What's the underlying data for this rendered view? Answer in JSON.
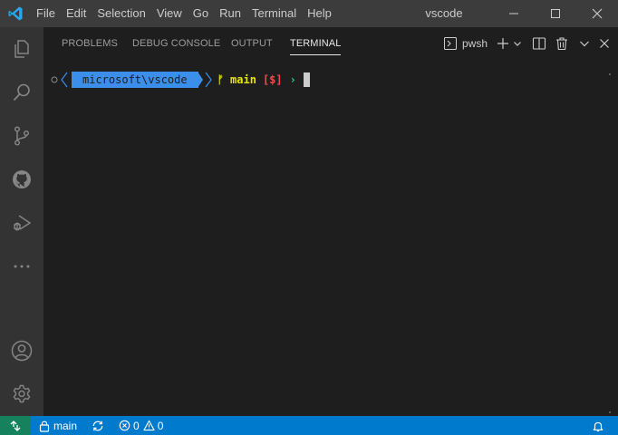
{
  "window": {
    "title": "vscode"
  },
  "menu": {
    "items": [
      "File",
      "Edit",
      "Selection",
      "View",
      "Go",
      "Run",
      "Terminal",
      "Help"
    ]
  },
  "panel": {
    "tabs": [
      {
        "label": "PROBLEMS",
        "active": false
      },
      {
        "label": "DEBUG CONSOLE",
        "active": false
      },
      {
        "label": "OUTPUT",
        "active": false
      },
      {
        "label": "TERMINAL",
        "active": true
      }
    ],
    "shell": "pwsh"
  },
  "terminal": {
    "path": "microsoft\\vscode",
    "branch": "main",
    "status": "[$]",
    "symbols": {
      "branch_glyph": "ᚠ",
      "prompt_glyph": "›"
    }
  },
  "statusbar": {
    "branch": "main",
    "errors": "0",
    "warnings": "0"
  },
  "icons": {
    "activity": [
      "explorer-icon",
      "search-icon",
      "source-control-icon",
      "github-icon",
      "run-debug-icon",
      "more-icon",
      "account-icon",
      "settings-gear-icon"
    ],
    "panel_actions": [
      "terminal-icon",
      "add-icon",
      "chevron-down-icon",
      "split-icon",
      "trash-icon",
      "chevron-down-icon",
      "close-icon"
    ]
  },
  "colors": {
    "accent": "#007acc",
    "remote": "#16825d",
    "path_bg": "#3b8eea",
    "branch": "#e5e510",
    "status": "#f14c4c",
    "prompt": "#23d18b",
    "logo": "#23a9f2"
  }
}
